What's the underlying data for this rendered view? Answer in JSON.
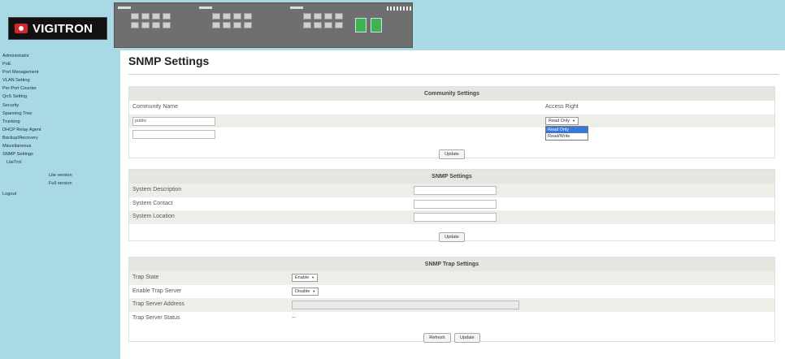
{
  "header": {
    "logo_text": "VIGITRON",
    "logo_mark_color": "#d9232d",
    "panel_label": "(rendered switch front panel image)"
  },
  "sidebar": {
    "items": [
      {
        "label": "Administrator"
      },
      {
        "label": "PoE"
      },
      {
        "label": "Port Management"
      },
      {
        "label": "VLAN Setting"
      },
      {
        "label": "Per Port Counter"
      },
      {
        "label": "QoS Setting"
      },
      {
        "label": "Security"
      },
      {
        "label": "Spanning Tree"
      },
      {
        "label": "Trunking"
      },
      {
        "label": "DHCP Relay Agent"
      },
      {
        "label": "Backup/Recovery"
      },
      {
        "label": "Miscellaneous"
      },
      {
        "label": "SNMP Settings"
      },
      {
        "label": "LiteTrol"
      }
    ],
    "sub_items": [
      {
        "label": "Lite version"
      },
      {
        "label": "Full version"
      }
    ],
    "logout": "Logout"
  },
  "main": {
    "title": "SNMP Settings",
    "community": {
      "heading": "Community Settings",
      "col_name": "Community Name",
      "col_access": "Access Right",
      "rows": [
        {
          "name": "public",
          "access": "Read Only"
        },
        {
          "name": "",
          "access": ""
        }
      ],
      "dropdown_options": [
        "Read Only",
        "Read/Write"
      ],
      "update_label": "Update"
    },
    "snmp": {
      "heading": "SNMP Settings",
      "fields": [
        {
          "label": "System Description",
          "value": ""
        },
        {
          "label": "System Contact",
          "value": ""
        },
        {
          "label": "System Location",
          "value": ""
        }
      ],
      "update_label": "Update"
    },
    "trap": {
      "heading": "SNMP Trap Settings",
      "trap_state_label": "Trap State",
      "trap_state_value": "Enable",
      "enable_server_label": "Enable Trap Server",
      "enable_server_value": "Disable",
      "server_address_label": "Trap Server Address",
      "server_address_value": "",
      "server_status_label": "Trap Server Status",
      "server_status_value": "--",
      "refresh_label": "Refresh",
      "update_label": "Update"
    }
  }
}
